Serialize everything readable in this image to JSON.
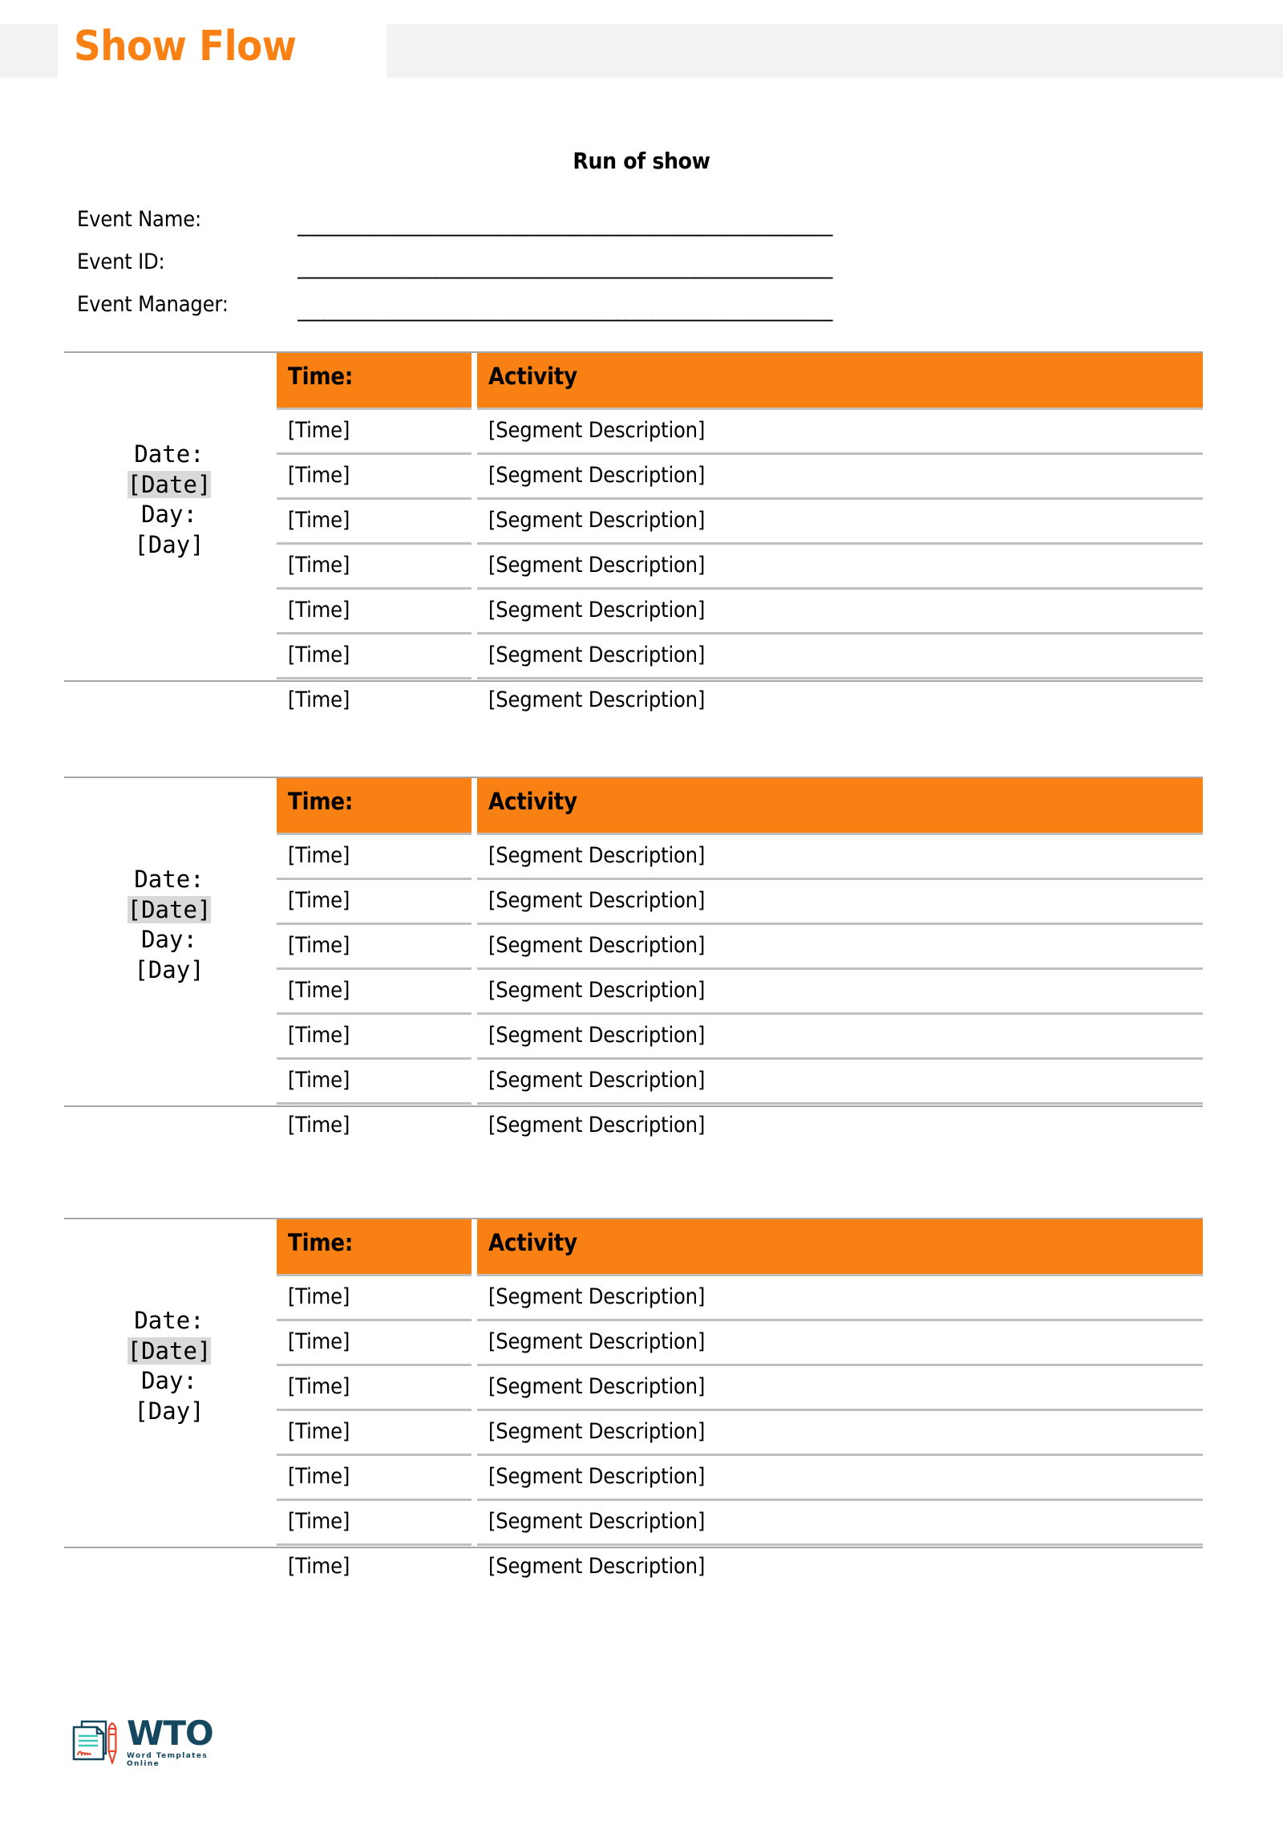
{
  "header": {
    "title": "Show Flow",
    "band_color": "#f2f2f2",
    "title_color": "#F98012"
  },
  "section_heading": "Run of show",
  "fields": [
    {
      "label": "Event Name:",
      "value": "",
      "line": "______________________________________________________________"
    },
    {
      "label": "Event ID:",
      "value": "",
      "line": "______________________________________________________________"
    },
    {
      "label": "Event Manager:",
      "value": "",
      "line": "______________________________________________________________"
    }
  ],
  "table": {
    "accent_color": "#F98012",
    "border_color": "#bfbfbf",
    "highlight_color": "#d9d9d9",
    "columns": [
      "Time:",
      "Activity"
    ],
    "date_label": "Date:",
    "date_value": "[Date]",
    "day_label": "Day:",
    "day_value": "[Day]",
    "row_time": "[Time]",
    "row_activity": "[Segment Description]"
  },
  "blocks": [
    {
      "date_label": "Date:",
      "date_value": "[Date]",
      "day_label": "Day:",
      "day_value": "[Day]",
      "header": {
        "time": "Time:",
        "activity": "Activity"
      },
      "rows": [
        {
          "time": "[Time]",
          "activity": "[Segment Description]"
        },
        {
          "time": "[Time]",
          "activity": "[Segment Description]"
        },
        {
          "time": "[Time]",
          "activity": "[Segment Description]"
        },
        {
          "time": "[Time]",
          "activity": "[Segment Description]"
        },
        {
          "time": "[Time]",
          "activity": "[Segment Description]"
        },
        {
          "time": "[Time]",
          "activity": "[Segment Description]"
        },
        {
          "time": "[Time]",
          "activity": "[Segment Description]"
        }
      ]
    },
    {
      "date_label": "Date:",
      "date_value": "[Date]",
      "day_label": "Day:",
      "day_value": "[Day]",
      "header": {
        "time": "Time:",
        "activity": "Activity"
      },
      "rows": [
        {
          "time": "[Time]",
          "activity": "[Segment Description]"
        },
        {
          "time": "[Time]",
          "activity": "[Segment Description]"
        },
        {
          "time": "[Time]",
          "activity": "[Segment Description]"
        },
        {
          "time": "[Time]",
          "activity": "[Segment Description]"
        },
        {
          "time": "[Time]",
          "activity": "[Segment Description]"
        },
        {
          "time": "[Time]",
          "activity": "[Segment Description]"
        },
        {
          "time": "[Time]",
          "activity": "[Segment Description]"
        }
      ]
    },
    {
      "date_label": "Date:",
      "date_value": "[Date]",
      "day_label": "Day:",
      "day_value": "[Day]",
      "header": {
        "time": "Time:",
        "activity": "Activity"
      },
      "rows": [
        {
          "time": "[Time]",
          "activity": "[Segment Description]"
        },
        {
          "time": "[Time]",
          "activity": "[Segment Description]"
        },
        {
          "time": "[Time]",
          "activity": "[Segment Description]"
        },
        {
          "time": "[Time]",
          "activity": "[Segment Description]"
        },
        {
          "time": "[Time]",
          "activity": "[Segment Description]"
        },
        {
          "time": "[Time]",
          "activity": "[Segment Description]"
        },
        {
          "time": "[Time]",
          "activity": "[Segment Description]"
        }
      ]
    }
  ],
  "footer": {
    "logo_mark": "document-pen-icon",
    "logo_name": "WTO",
    "logo_tagline": "Word Templates Online",
    "logo_color": "#15475f",
    "logo_accent": "#e8452c",
    "logo_line_color": "#3fc6b7"
  }
}
